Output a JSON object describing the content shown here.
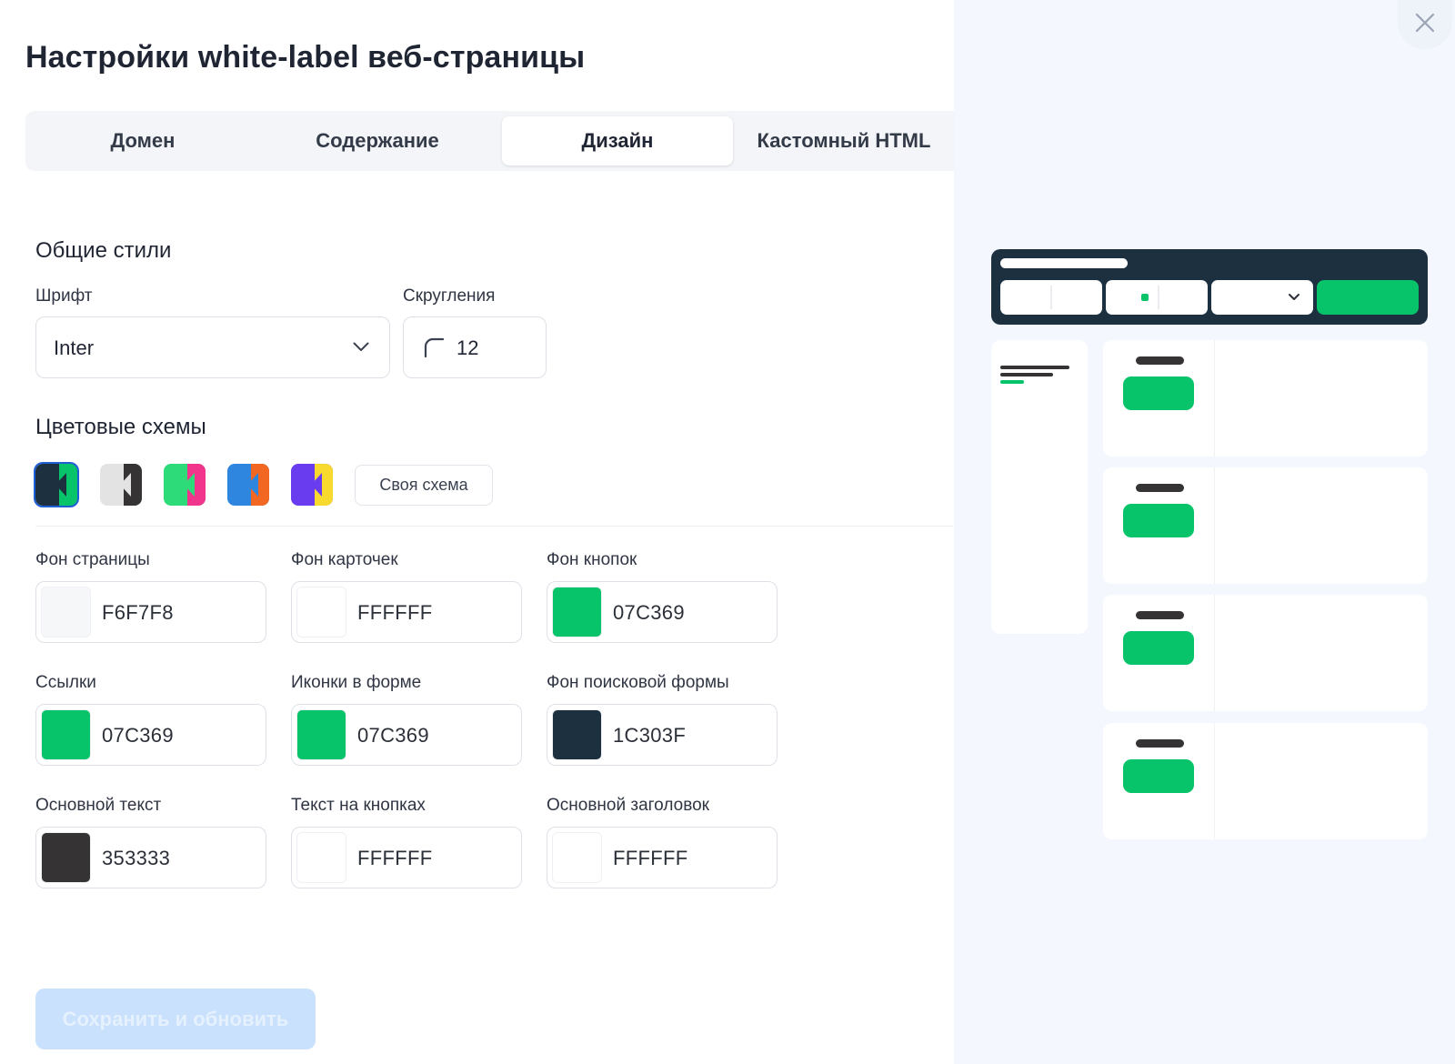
{
  "page": {
    "title": "Настройки white-label веб-страницы"
  },
  "tabs": [
    {
      "label": "Домен"
    },
    {
      "label": "Содержание"
    },
    {
      "label": "Дизайн",
      "active": true
    },
    {
      "label": "Кастомный HTML"
    }
  ],
  "general": {
    "title": "Общие стили",
    "font_label": "Шрифт",
    "font_value": "Inter",
    "radius_label": "Скругления",
    "radius_value": "12"
  },
  "schemes": {
    "title": "Цветовые схемы",
    "own_label": "Своя схема",
    "selected_index": 0,
    "items": [
      {
        "bg": "#1C303F",
        "accent": "#07C369",
        "mark": "#1C303F"
      },
      {
        "bg": "#E3E3E3",
        "accent": "#353333",
        "mark": "#E3E3E3"
      },
      {
        "bg": "#2EDB79",
        "accent": "#F2358C",
        "mark": "#2EDB79"
      },
      {
        "bg": "#2F86DE",
        "accent": "#F26722",
        "mark": "#2F86DE"
      },
      {
        "bg": "#6A3CF0",
        "accent": "#F8D92E",
        "mark": "#6A3CF0"
      }
    ]
  },
  "colors": [
    {
      "label": "Фон страницы",
      "hex": "F6F7F8",
      "swatch": "#F6F7F8"
    },
    {
      "label": "Фон карточек",
      "hex": "FFFFFF",
      "swatch": "#FFFFFF"
    },
    {
      "label": "Фон кнопок",
      "hex": "07C369",
      "swatch": "#07C369"
    },
    {
      "label": "Ссылки",
      "hex": "07C369",
      "swatch": "#07C369"
    },
    {
      "label": "Иконки в форме",
      "hex": "07C369",
      "swatch": "#07C369"
    },
    {
      "label": "Фон поисковой формы",
      "hex": "1C303F",
      "swatch": "#1C303F"
    },
    {
      "label": "Основной текст",
      "hex": "353333",
      "swatch": "#353333"
    },
    {
      "label": "Текст на кнопках",
      "hex": "FFFFFF",
      "swatch": "#FFFFFF"
    },
    {
      "label": "Основной заголовок",
      "hex": "FFFFFF",
      "swatch": "#FFFFFF"
    }
  ],
  "actions": {
    "save_label": "Сохранить и обновить"
  },
  "preview": {
    "search_bg": "#1C303F",
    "button_color": "#07C369",
    "text_color": "#353333",
    "card_bg": "#FFFFFF",
    "page_bg": "#F4F7FD"
  }
}
